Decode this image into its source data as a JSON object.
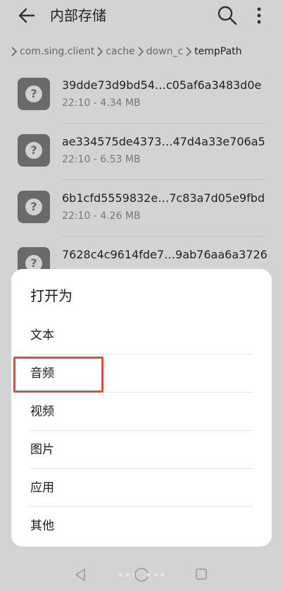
{
  "header": {
    "title": "内部存储",
    "back_icon": "arrow-left-icon",
    "search_icon": "search-icon",
    "more_icon": "more-vertical-icon"
  },
  "breadcrumb": [
    "com.sing.client",
    "cache",
    "down_c",
    "tempPath"
  ],
  "files": [
    {
      "name": "39dde73d9bd54…c05af6a3483d0e",
      "meta": "22:10 - 4.34 MB"
    },
    {
      "name": "ae334575de4373…47d4a33e706a5",
      "meta": "22:10 - 6.53 MB"
    },
    {
      "name": "6b1cfd5559832e…7c83a7d05e9fbd",
      "meta": "22:10 - 4.26 MB"
    },
    {
      "name": "7628c4c9614fde7…9ab76aa6a3726",
      "meta": ""
    }
  ],
  "file_icon_glyph": "?",
  "open_with": {
    "title": "打开为",
    "options": [
      "文本",
      "音频",
      "视频",
      "图片",
      "应用",
      "其他"
    ],
    "highlighted_index": 1
  },
  "colors": {
    "background": "#d3d3d3",
    "sheet": "#ffffff",
    "highlight_border": "#e24a3b",
    "file_icon": "#6a6a6a"
  }
}
